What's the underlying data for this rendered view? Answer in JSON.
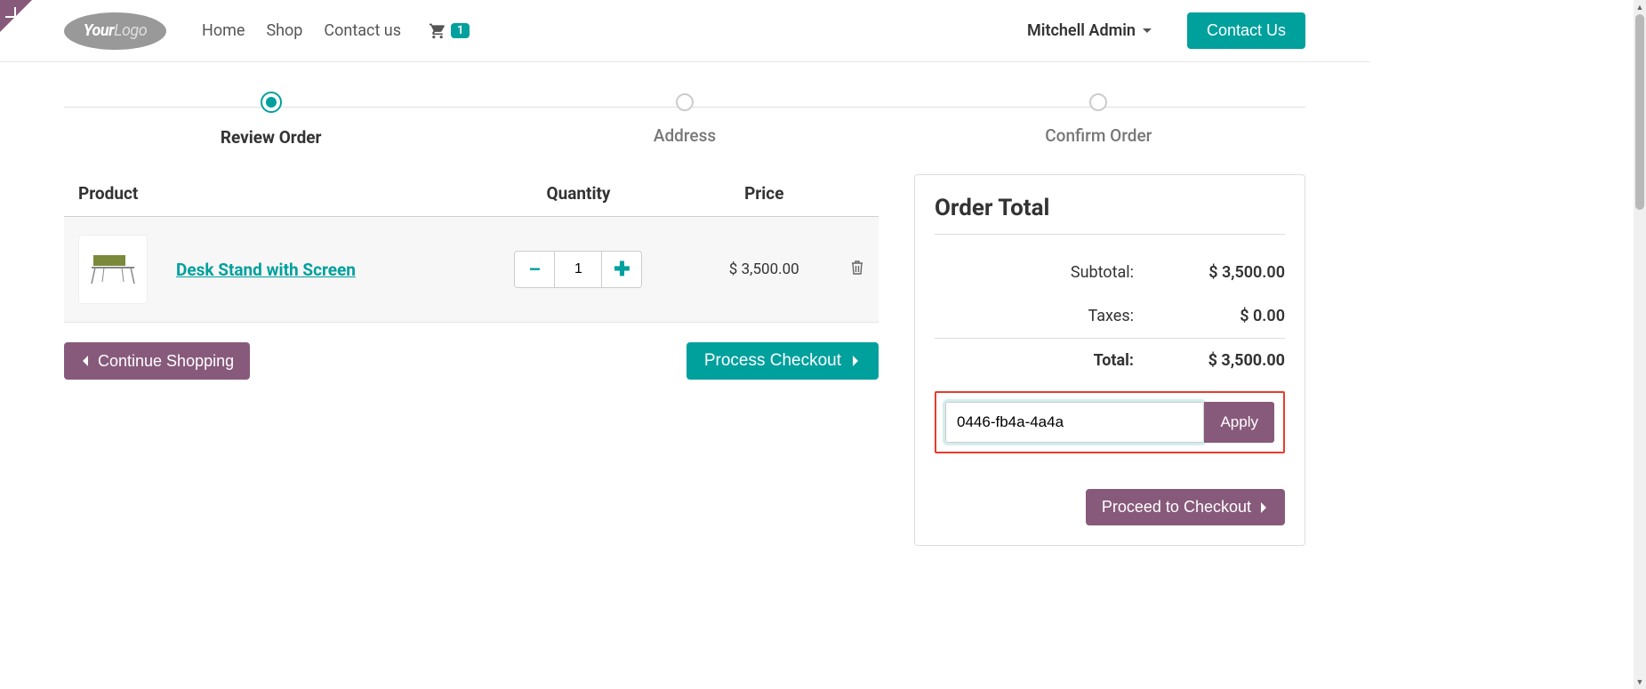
{
  "header": {
    "logo_part1": "Your",
    "logo_part2": "Logo",
    "nav": {
      "home": "Home",
      "shop": "Shop",
      "contact": "Contact us"
    },
    "cart_count": "1",
    "user_name": "Mitchell Admin",
    "contact_btn": "Contact Us"
  },
  "wizard": {
    "step1": "Review Order",
    "step2": "Address",
    "step3": "Confirm Order"
  },
  "cart": {
    "col_product": "Product",
    "col_qty": "Quantity",
    "col_price": "Price",
    "items": [
      {
        "name": "Desk Stand with Screen",
        "qty": "1",
        "price": "$ 3,500.00"
      }
    ],
    "continue_btn": "Continue Shopping",
    "checkout_btn": "Process Checkout"
  },
  "order_total": {
    "title": "Order Total",
    "subtotal_label": "Subtotal:",
    "subtotal_value": "$ 3,500.00",
    "taxes_label": "Taxes:",
    "taxes_value": "$ 0.00",
    "total_label": "Total:",
    "total_value": "$ 3,500.00",
    "promo_value": "0446-fb4a-4a4a",
    "apply_btn": "Apply",
    "proceed_btn": "Proceed to Checkout"
  }
}
